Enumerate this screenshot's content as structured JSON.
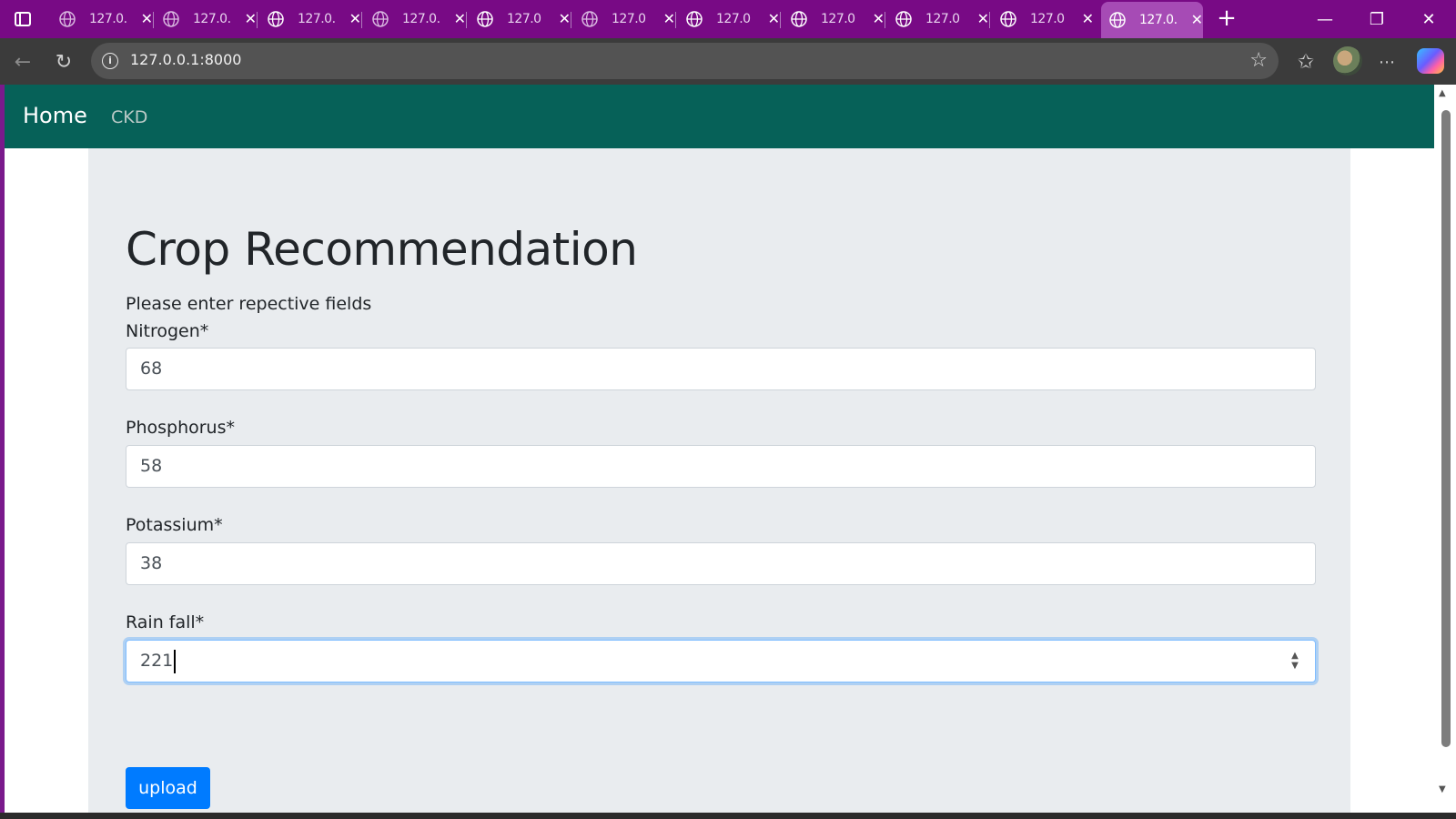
{
  "browser": {
    "tabs": [
      {
        "label": "127.0."
      },
      {
        "label": "127.0."
      },
      {
        "label": "127.0."
      },
      {
        "label": "127.0."
      },
      {
        "label": "127.0"
      },
      {
        "label": "127.0"
      },
      {
        "label": "127.0"
      },
      {
        "label": "127.0"
      },
      {
        "label": "127.0"
      },
      {
        "label": "127.0"
      },
      {
        "label": "127.0."
      }
    ],
    "address": "127.0.0.1:8000"
  },
  "nav": {
    "home": "Home",
    "ckd": "CKD"
  },
  "form": {
    "title": "Crop Recommendation",
    "subtitle": "Please enter repective fields",
    "fields": [
      {
        "label": "Nitrogen*",
        "value": "68"
      },
      {
        "label": "Phosphorus*",
        "value": "58"
      },
      {
        "label": "Potassium*",
        "value": "38"
      },
      {
        "label": "Rain fall*",
        "value": "221"
      }
    ],
    "submit": "upload"
  },
  "colors": {
    "tabstrip": "#780a85",
    "navbar": "#066158",
    "button": "#007bff"
  }
}
